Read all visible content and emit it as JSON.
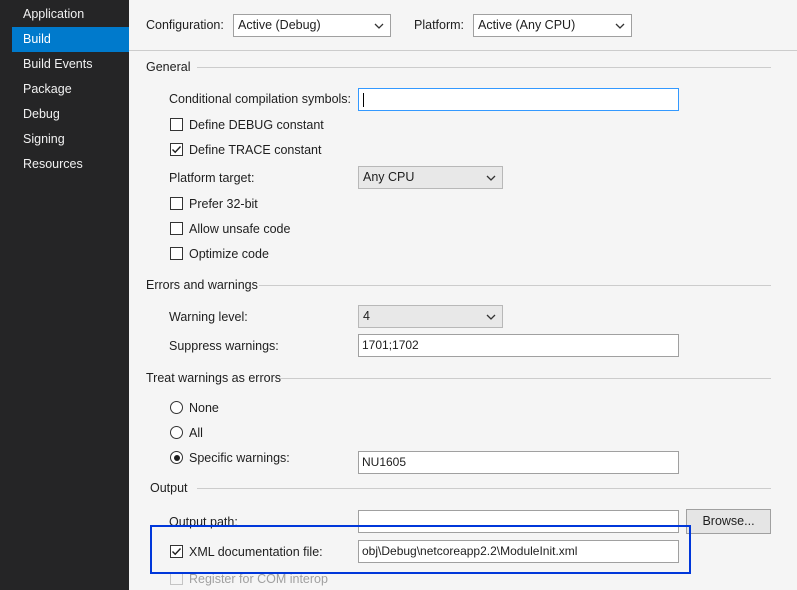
{
  "sidebar": {
    "items": [
      {
        "label": "Application",
        "selected": false
      },
      {
        "label": "Build",
        "selected": true
      },
      {
        "label": "Build Events",
        "selected": false
      },
      {
        "label": "Package",
        "selected": false
      },
      {
        "label": "Debug",
        "selected": false
      },
      {
        "label": "Signing",
        "selected": false
      },
      {
        "label": "Resources",
        "selected": false
      }
    ]
  },
  "topbar": {
    "configuration_label": "Configuration:",
    "configuration_value": "Active (Debug)",
    "platform_label": "Platform:",
    "platform_value": "Active (Any CPU)"
  },
  "general": {
    "title": "General",
    "conditional_symbols_label": "Conditional compilation symbols:",
    "conditional_symbols_value": "",
    "define_debug_label": "Define DEBUG constant",
    "define_debug_checked": false,
    "define_trace_label": "Define TRACE constant",
    "define_trace_checked": true,
    "platform_target_label": "Platform target:",
    "platform_target_value": "Any CPU",
    "prefer32_label": "Prefer 32-bit",
    "prefer32_checked": false,
    "unsafe_label": "Allow unsafe code",
    "unsafe_checked": false,
    "optimize_label": "Optimize code",
    "optimize_checked": false
  },
  "errors": {
    "title": "Errors and warnings",
    "warning_level_label": "Warning level:",
    "warning_level_value": "4",
    "suppress_label": "Suppress warnings:",
    "suppress_value": "1701;1702"
  },
  "treat": {
    "title": "Treat warnings as errors",
    "none_label": "None",
    "all_label": "All",
    "specific_label": "Specific warnings:",
    "specific_value": "NU1605",
    "selected": "specific"
  },
  "output": {
    "title": "Output",
    "output_path_label": "Output path:",
    "output_path_value": "",
    "browse_label": "Browse...",
    "xml_doc_label": "XML documentation file:",
    "xml_doc_checked": true,
    "xml_doc_value": "obj\\Debug\\netcoreapp2.2\\ModuleInit.xml",
    "com_interop_label": "Register for COM interop",
    "com_interop_checked": false
  },
  "colors": {
    "sidebar_bg": "#252526",
    "selection": "#007acc",
    "annotation": "#0037da"
  }
}
